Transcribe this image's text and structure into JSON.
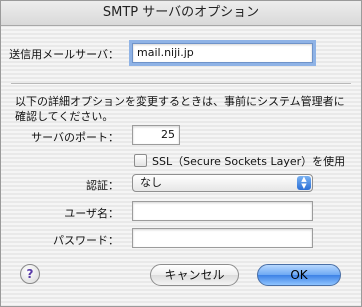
{
  "window": {
    "title": "SMTP サーバのオプション"
  },
  "outgoing_server": {
    "label": "送信用メールサーバ：",
    "value": "mail.niji.jp"
  },
  "description": "以下の詳細オプションを変更するときは、事前にシステム管理者に確認してください。",
  "port": {
    "label": "サーバのポート：",
    "value": "25"
  },
  "ssl": {
    "label": "SSL（Secure Sockets Layer）を使用",
    "checked": false
  },
  "auth": {
    "label": "認証：",
    "selected": "なし"
  },
  "username": {
    "label": "ユーザ名：",
    "value": ""
  },
  "password": {
    "label": "パスワード：",
    "value": ""
  },
  "buttons": {
    "help": "?",
    "cancel": "キャンセル",
    "ok": "OK"
  },
  "icons": {
    "popup_arrows": "up-down-arrows-icon",
    "help": "help-icon"
  }
}
